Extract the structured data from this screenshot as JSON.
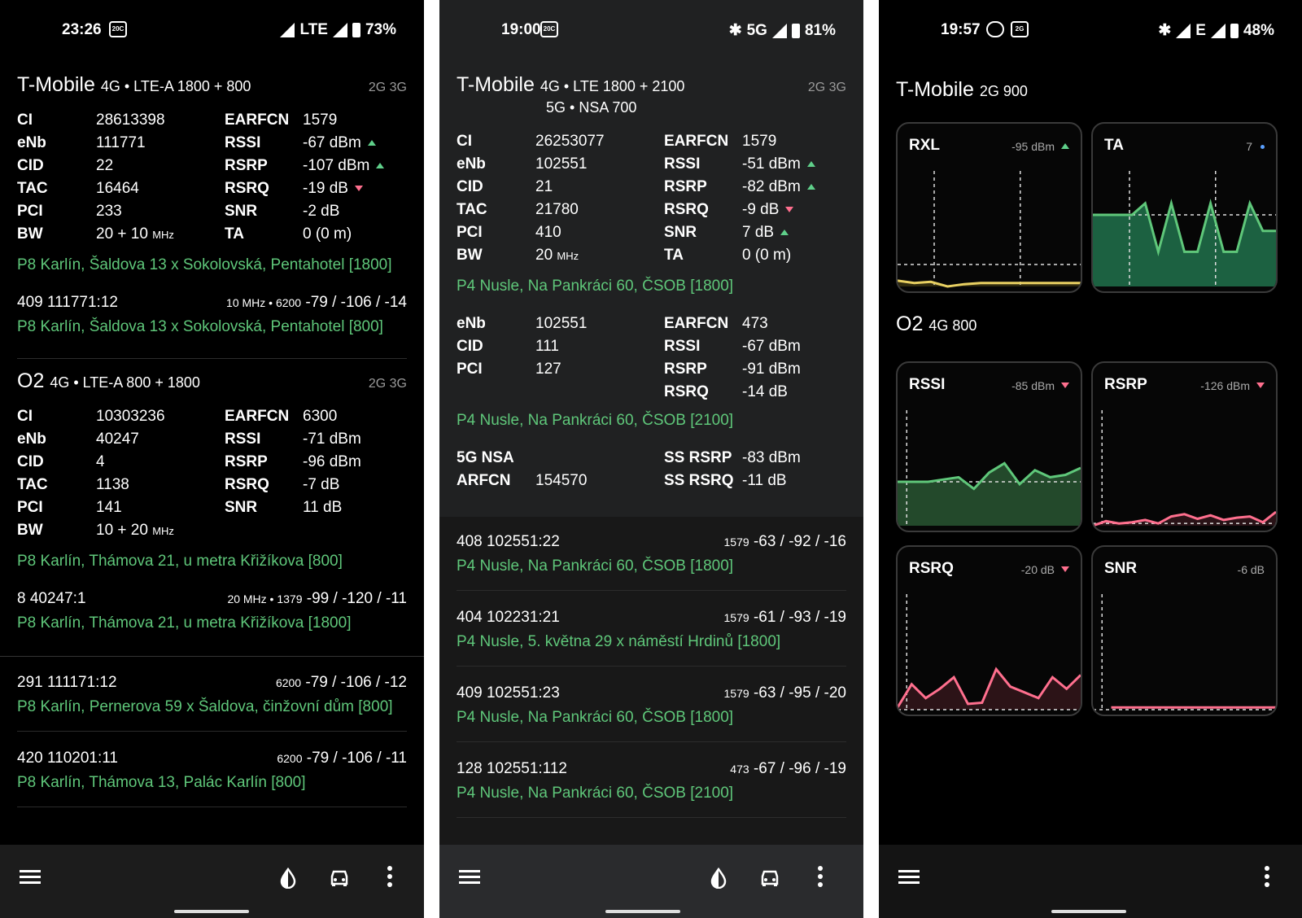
{
  "colors": {
    "green": "#5fc77a",
    "red": "#ff6f8e",
    "yellow": "#e8d062",
    "blue": "#5aa0ff"
  },
  "icons": [
    "signal-icon",
    "battery-icon",
    "bluetooth-icon",
    "whatsapp-icon",
    "menu-icon",
    "contrast-drop-icon",
    "car-icon",
    "more-vert-icon"
  ],
  "p1": {
    "status": {
      "time": "23:26",
      "notif": "20C",
      "network": "LTE",
      "battery": "73%"
    },
    "op1": {
      "name": "T-Mobile",
      "tech": "4G • LTE-A 1800 + 800",
      "gen": "2G 3G",
      "left": [
        [
          "CI",
          "28613398"
        ],
        [
          "eNb",
          "111771"
        ],
        [
          "CID",
          "22"
        ],
        [
          "TAC",
          "16464"
        ],
        [
          "PCI",
          "233"
        ],
        [
          "BW",
          "20 + 10"
        ]
      ],
      "bw_unit": "MHz",
      "right": [
        [
          "EARFCN",
          "1579",
          ""
        ],
        [
          "RSSI",
          "-67 dBm",
          "up"
        ],
        [
          "RSRP",
          "-107 dBm",
          "up"
        ],
        [
          "RSRQ",
          "-19 dB",
          "down"
        ],
        [
          "SNR",
          "-2 dB",
          ""
        ],
        [
          "TA",
          "0 (0 m)",
          ""
        ]
      ],
      "loc": "P8 Karlín, Šaldova 13 x Sokolovská, Pentahotel [1800]",
      "n_id": "409  111771:12",
      "n_meta1": "10 MHz • 6200",
      "n_vals": "-79 / -106 / -14",
      "n_loc": "P8 Karlín, Šaldova 13 x Sokolovská, Pentahotel [800]"
    },
    "op2": {
      "name": "O2",
      "tech": "4G • LTE-A 800 + 1800",
      "gen": "2G 3G",
      "left": [
        [
          "CI",
          "10303236"
        ],
        [
          "eNb",
          "40247"
        ],
        [
          "CID",
          "4"
        ],
        [
          "TAC",
          "1138"
        ],
        [
          "PCI",
          "141"
        ],
        [
          "BW",
          "10 + 20"
        ]
      ],
      "bw_unit": "MHz",
      "right": [
        [
          "EARFCN",
          "6300"
        ],
        [
          "RSSI",
          "-71 dBm"
        ],
        [
          "RSRP",
          "-96 dBm"
        ],
        [
          "RSRQ",
          "-7 dB"
        ],
        [
          "SNR",
          "11 dB"
        ]
      ],
      "loc": "P8 Karlín, Thámova 21, u metra Křižíkova [800]",
      "n_id": "8  40247:1",
      "n_meta1": "20 MHz • 1379",
      "n_vals": "-99 / -120 / -11",
      "n_loc": "P8 Karlín, Thámova 21, u metra Křižíkova [1800]"
    },
    "list": [
      {
        "id": "291  111171:12",
        "meta": "6200",
        "vals": "-79 / -106 / -12",
        "loc": "P8 Karlín, Pernerova 59 x Šaldova, činžovní dům [800]"
      },
      {
        "id": "420  110201:11",
        "meta": "6200",
        "vals": "-79 / -106 / -11",
        "loc": "P8 Karlín, Thámova 13, Palác Karlín [800]"
      }
    ]
  },
  "p2": {
    "status": {
      "time": "19:00",
      "notif": "20C",
      "network": "5G",
      "battery": "81%"
    },
    "name": "T-Mobile",
    "tech1": "4G • LTE 1800 + 2100",
    "tech2": "5G • NSA 700",
    "gen": "2G 3G",
    "left": [
      [
        "CI",
        "26253077"
      ],
      [
        "eNb",
        "102551"
      ],
      [
        "CID",
        "21"
      ],
      [
        "TAC",
        "21780"
      ],
      [
        "PCI",
        "410"
      ],
      [
        "BW",
        "20"
      ]
    ],
    "bw_unit": "MHz",
    "right": [
      [
        "EARFCN",
        "1579",
        ""
      ],
      [
        "RSSI",
        "-51 dBm",
        "up"
      ],
      [
        "RSRP",
        "-82 dBm",
        "up"
      ],
      [
        "RSRQ",
        "-9 dB",
        "down"
      ],
      [
        "SNR",
        "7 dB",
        "up"
      ],
      [
        "TA",
        "0 (0 m)",
        ""
      ]
    ],
    "loc": "P4 Nusle, Na Pankráci 60, ČSOB [1800]",
    "c2left": [
      [
        "eNb",
        "102551"
      ],
      [
        "CID",
        "111"
      ],
      [
        "PCI",
        "127"
      ]
    ],
    "c2right": [
      [
        "EARFCN",
        "473"
      ],
      [
        "RSSI",
        "-67 dBm"
      ],
      [
        "RSRP",
        "-91 dBm"
      ],
      [
        "RSRQ",
        "-14 dB"
      ]
    ],
    "loc2": "P4 Nusle, Na Pankráci 60, ČSOB [2100]",
    "nsa": {
      "title": "5G NSA",
      "arfcn_l": "ARFCN",
      "arfcn": "154570",
      "r1l": "SS RSRP",
      "r1": "-83 dBm",
      "r2l": "SS RSRQ",
      "r2": "-11 dB"
    },
    "list": [
      {
        "id": "408  102551:22",
        "meta": "1579",
        "vals": "-63 / -92 / -16",
        "loc": "P4 Nusle, Na Pankráci 60, ČSOB [1800]"
      },
      {
        "id": "404  102231:21",
        "meta": "1579",
        "vals": "-61 / -93 / -19",
        "loc": "P4 Nusle, 5. května 29 x náměstí Hrdinů [1800]"
      },
      {
        "id": "409  102551:23",
        "meta": "1579",
        "vals": "-63 / -95 / -20",
        "loc": "P4 Nusle, Na Pankráci 60, ČSOB [1800]"
      },
      {
        "id": "128  102551:112",
        "meta": "473",
        "vals": "-67 / -96 / -19",
        "loc": "P4 Nusle, Na Pankráci 60, ČSOB [2100]"
      }
    ]
  },
  "p3": {
    "status": {
      "time": "19:57",
      "notif": "2G",
      "network": "E",
      "battery": "48%"
    },
    "op1": {
      "name": "T-Mobile",
      "tech": "2G 900"
    },
    "op2": {
      "name": "O2",
      "tech": "4G 800"
    },
    "cards": [
      {
        "title": "RXL",
        "value": "-95 dBm",
        "trend": "up"
      },
      {
        "title": "TA",
        "value": "7",
        "trend": "dot"
      },
      {
        "title": "RSSI",
        "value": "-85 dBm",
        "trend": "down"
      },
      {
        "title": "RSRP",
        "value": "-126 dBm",
        "trend": "down"
      },
      {
        "title": "RSRQ",
        "value": "-20 dB",
        "trend": "down"
      },
      {
        "title": "SNR",
        "value": "-6 dB",
        "trend": ""
      }
    ]
  }
}
